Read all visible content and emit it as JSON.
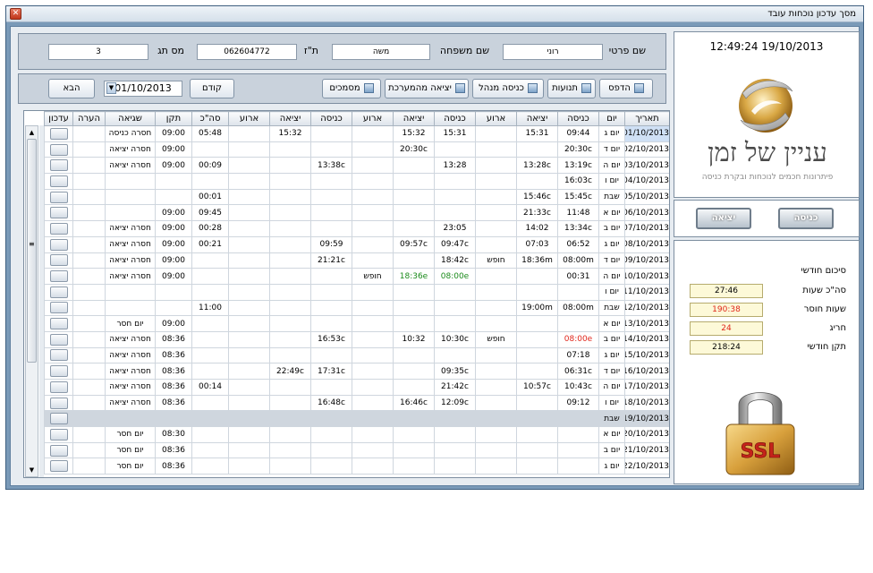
{
  "window": {
    "title": "מסך עדכון נוכחות עובד",
    "close_glyph": "✕"
  },
  "employee": {
    "first_name_label": "שם פרטי",
    "first_name": "רוני",
    "last_name_label": "שם משפחה",
    "last_name": "משה",
    "id_label": "ת\"ז",
    "id_value": "062604772",
    "tag_label": "מס תג",
    "tag_value": "3"
  },
  "toolbar": {
    "print": "הדפס",
    "movements": "תנועות",
    "manager_entry": "כניסה מנהל",
    "system_exit": "יציאה מהמערכת",
    "documents": "מסמכים",
    "prev": "קודם",
    "month_value": "01/10/2013",
    "next": "הבא"
  },
  "grid": {
    "columns": [
      "תאריך",
      "יום",
      "כניסה",
      "יציאה",
      "ארוע",
      "כניסה",
      "יציאה",
      "ארוע",
      "כניסה",
      "יציאה",
      "ארוע",
      "סה\"כ",
      "תקן",
      "שגיאה",
      "הערה",
      "עדכון"
    ],
    "rows": [
      {
        "date": "01/10/2013",
        "day": "יום ג",
        "in1": "09:44",
        "out1": "15:31",
        "ev1": "",
        "in2": "15:31",
        "out2": "15:32",
        "ev2": "",
        "in3": "",
        "out3": "15:32",
        "ev3": "",
        "total": "05:48",
        "std": "09:00",
        "err": "חסרה כניסה",
        "note": "",
        "cls": ""
      },
      {
        "date": "02/10/2013",
        "day": "יום ד",
        "in1": "20:30c",
        "out1": "",
        "ev1": "",
        "in2": "",
        "out2": "20:30c",
        "ev2": "",
        "in3": "",
        "out3": "",
        "ev3": "",
        "total": "",
        "std": "09:00",
        "err": "חסרה יציאה",
        "note": "",
        "cls": ""
      },
      {
        "date": "03/10/2013",
        "day": "יום ה",
        "in1": "13:19c",
        "out1": "13:28c",
        "ev1": "",
        "in2": "13:28",
        "out2": "",
        "ev2": "",
        "in3": "13:38c",
        "out3": "",
        "ev3": "",
        "total": "00:09",
        "std": "09:00",
        "err": "חסרה יציאה",
        "note": "",
        "cls": ""
      },
      {
        "date": "04/10/2013",
        "day": "יום ו",
        "in1": "16:03c",
        "out1": "",
        "ev1": "",
        "in2": "",
        "out2": "",
        "ev2": "",
        "in3": "",
        "out3": "",
        "ev3": "",
        "total": "",
        "std": "",
        "err": "",
        "note": "",
        "cls": ""
      },
      {
        "date": "05/10/2013",
        "day": "שבת",
        "in1": "15:45c",
        "out1": "15:46c",
        "ev1": "",
        "in2": "",
        "out2": "",
        "ev2": "",
        "in3": "",
        "out3": "",
        "ev3": "",
        "total": "00:01",
        "std": "",
        "err": "",
        "note": "",
        "cls": ""
      },
      {
        "date": "06/10/2013",
        "day": "יום א",
        "in1": "11:48",
        "out1": "21:33c",
        "ev1": "",
        "in2": "",
        "out2": "",
        "ev2": "",
        "in3": "",
        "out3": "",
        "ev3": "",
        "total": "09:45",
        "std": "09:00",
        "err": "",
        "note": "",
        "cls": ""
      },
      {
        "date": "07/10/2013",
        "day": "יום ב",
        "in1": "13:34c",
        "out1": "14:02",
        "ev1": "",
        "in2": "23:05",
        "out2": "",
        "ev2": "",
        "in3": "",
        "out3": "",
        "ev3": "",
        "total": "00:28",
        "std": "09:00",
        "err": "חסרה יציאה",
        "note": "",
        "cls": ""
      },
      {
        "date": "08/10/2013",
        "day": "יום ג",
        "in1": "06:52",
        "out1": "07:03",
        "ev1": "",
        "in2": "09:47c",
        "out2": "09:57c",
        "ev2": "",
        "in3": "09:59",
        "out3": "",
        "ev3": "",
        "total": "00:21",
        "std": "09:00",
        "err": "חסרה יציאה",
        "note": "",
        "cls": ""
      },
      {
        "date": "09/10/2013",
        "day": "יום ד",
        "in1": "08:00m",
        "out1": "18:36m",
        "ev1": "חופש",
        "in2": "18:42c",
        "out2": "",
        "ev2": "",
        "in3": "21:21c",
        "out3": "",
        "ev3": "",
        "total": "",
        "std": "09:00",
        "err": "חסרה יציאה",
        "note": "",
        "cls": ""
      },
      {
        "date": "10/10/2013",
        "day": "יום ה",
        "in1": "00:31",
        "out1": "",
        "ev1": "",
        "in2": "08:00e",
        "out2": "18:36e",
        "ev2": "חופש",
        "in3": "",
        "out3": "",
        "ev3": "",
        "total": "",
        "std": "09:00",
        "err": "חסרה יציאה",
        "note": "",
        "cls": "green23"
      },
      {
        "date": "11/10/2013",
        "day": "יום ו",
        "in1": "",
        "out1": "",
        "ev1": "",
        "in2": "",
        "out2": "",
        "ev2": "",
        "in3": "",
        "out3": "",
        "ev3": "",
        "total": "",
        "std": "",
        "err": "",
        "note": "",
        "cls": ""
      },
      {
        "date": "12/10/2013",
        "day": "שבת",
        "in1": "08:00m",
        "out1": "19:00m",
        "ev1": "",
        "in2": "",
        "out2": "",
        "ev2": "",
        "in3": "",
        "out3": "",
        "ev3": "",
        "total": "11:00",
        "std": "",
        "err": "",
        "note": "",
        "cls": ""
      },
      {
        "date": "13/10/2013",
        "day": "יום א",
        "in1": "",
        "out1": "",
        "ev1": "",
        "in2": "",
        "out2": "",
        "ev2": "",
        "in3": "",
        "out3": "",
        "ev3": "",
        "total": "",
        "std": "09:00",
        "err": "יום חסר",
        "note": "",
        "cls": ""
      },
      {
        "date": "14/10/2013",
        "day": "יום ב",
        "in1": "08:00e",
        "out1": "",
        "ev1": "חופש",
        "in2": "10:30c",
        "out2": "10:32",
        "ev2": "",
        "in3": "16:53c",
        "out3": "",
        "ev3": "",
        "total": "",
        "std": "08:36",
        "err": "חסרה יציאה",
        "note": "",
        "cls": "red1"
      },
      {
        "date": "15/10/2013",
        "day": "יום ג",
        "in1": "07:18",
        "out1": "",
        "ev1": "",
        "in2": "",
        "out2": "",
        "ev2": "",
        "in3": "",
        "out3": "",
        "ev3": "",
        "total": "",
        "std": "08:36",
        "err": "חסרה יציאה",
        "note": "",
        "cls": ""
      },
      {
        "date": "16/10/2013",
        "day": "יום ד",
        "in1": "06:31c",
        "out1": "",
        "ev1": "",
        "in2": "09:35c",
        "out2": "",
        "ev2": "",
        "in3": "17:31c",
        "out3": "22:49c",
        "ev3": "",
        "total": "",
        "std": "08:36",
        "err": "חסרה יציאה",
        "note": "",
        "cls": ""
      },
      {
        "date": "17/10/2013",
        "day": "יום ה",
        "in1": "10:43c",
        "out1": "10:57c",
        "ev1": "",
        "in2": "21:42c",
        "out2": "",
        "ev2": "",
        "in3": "",
        "out3": "",
        "ev3": "",
        "total": "00:14",
        "std": "08:36",
        "err": "חסרה יציאה",
        "note": "",
        "cls": ""
      },
      {
        "date": "18/10/2013",
        "day": "יום ו",
        "in1": "09:12",
        "out1": "",
        "ev1": "",
        "in2": "12:09c",
        "out2": "16:46c",
        "ev2": "",
        "in3": "16:48c",
        "out3": "",
        "ev3": "",
        "total": "",
        "std": "08:36",
        "err": "חסרה יציאה",
        "note": "",
        "cls": ""
      },
      {
        "date": "19/10/2013",
        "day": "שבת",
        "in1": "",
        "out1": "",
        "ev1": "",
        "in2": "",
        "out2": "",
        "ev2": "",
        "in3": "",
        "out3": "",
        "ev3": "",
        "total": "",
        "std": "",
        "err": "",
        "note": "",
        "cls": "holiday"
      },
      {
        "date": "20/10/2013",
        "day": "יום א",
        "in1": "",
        "out1": "",
        "ev1": "",
        "in2": "",
        "out2": "",
        "ev2": "",
        "in3": "",
        "out3": "",
        "ev3": "",
        "total": "",
        "std": "08:30",
        "err": "יום חסר",
        "note": "",
        "cls": ""
      },
      {
        "date": "21/10/2013",
        "day": "יום ב",
        "in1": "",
        "out1": "",
        "ev1": "",
        "in2": "",
        "out2": "",
        "ev2": "",
        "in3": "",
        "out3": "",
        "ev3": "",
        "total": "",
        "std": "08:36",
        "err": "יום חסר",
        "note": "",
        "cls": ""
      },
      {
        "date": "22/10/2013",
        "day": "יום ג",
        "in1": "",
        "out1": "",
        "ev1": "",
        "in2": "",
        "out2": "",
        "ev2": "",
        "in3": "",
        "out3": "",
        "ev3": "",
        "total": "",
        "std": "08:36",
        "err": "יום חסר",
        "note": "",
        "cls": ""
      }
    ]
  },
  "scrollbar": {
    "up": "▲",
    "down": "▼",
    "grip": "≡"
  },
  "side": {
    "clock": "12:49:24 19/10/2013",
    "logo_text": "עניין של זמן",
    "logo_sub": "פיתרונות חכמים לנוכחות ובקרת כניסה",
    "entry_button": "כניסה",
    "exit_button": "יציאה",
    "summary_title": "סיכום חודשי",
    "summary": [
      {
        "label": "סה\"כ שעות",
        "value": "27:46",
        "color": "#000000"
      },
      {
        "label": "שעות חוסר",
        "value": "190:38",
        "color": "#e0261b"
      },
      {
        "label": "חריג",
        "value": "24",
        "color": "#e0261b"
      },
      {
        "label": "תקן חודשי",
        "value": "218:24",
        "color": "#000000"
      }
    ],
    "ssl_label": "SSL"
  }
}
